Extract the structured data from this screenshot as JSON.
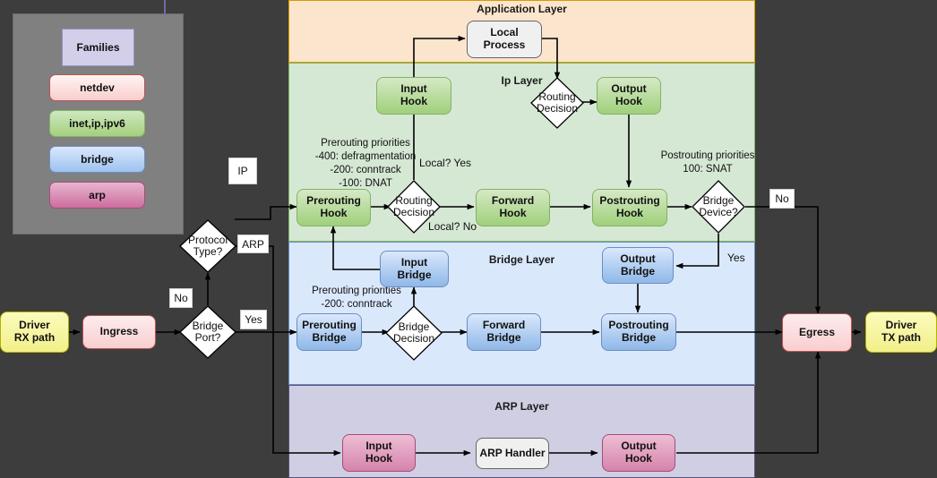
{
  "legend": {
    "title": "Families",
    "items": [
      {
        "label": "netdev",
        "color": "#f8cecc"
      },
      {
        "label": "inet,ip,ipv6",
        "color": "#a4d07f"
      },
      {
        "label": "bridge",
        "color": "#9cc2ef"
      },
      {
        "label": "arp",
        "color": "#cd6d9e"
      }
    ]
  },
  "layers": [
    {
      "key": "application",
      "title": "Application Layer",
      "bg": "#fce5cd",
      "border": "#d79b00"
    },
    {
      "key": "ip",
      "title": "Ip Layer",
      "bg": "#d5e8d4",
      "border": "#82b366"
    },
    {
      "key": "bridge",
      "title": "Bridge Layer",
      "bg": "#dae8fc",
      "border": "#6c8ebf"
    },
    {
      "key": "arp",
      "title": "ARP Layer",
      "bg": "#d0cee2",
      "border": "#56517e"
    }
  ],
  "nodes": {
    "driver_rx": "Driver\nRX path",
    "ingress": "Ingress",
    "egress": "Egress",
    "driver_tx": "Driver\nTX path",
    "local_process": "Local\nProcess",
    "ip_input_hook": "Input\nHook",
    "ip_output_hook": "Output\nHook",
    "ip_prerouting_hook": "Prerouting\nHook",
    "ip_forward_hook": "Forward\nHook",
    "ip_postrouting_hook": "Postrouting\nHook",
    "bridge_input": "Input\nBridge",
    "bridge_output": "Output\nBridge",
    "bridge_prerouting": "Prerouting\nBridge",
    "bridge_forward": "Forward\nBridge",
    "bridge_postrouting": "Postrouting\nBridge",
    "arp_input_hook": "Input\nHook",
    "arp_handler": "ARP Handler",
    "arp_output_hook": "Output\nHook"
  },
  "decisions": {
    "bridge_port": "Bridge\nPort?",
    "protocol_type": "Protocol\nType?",
    "ip_routing": "Routing\nDecision",
    "ip_routing_top": "Routing\nDecision",
    "bridge_device": "Bridge\nDevice?",
    "bridge_decision": "Bridge\nDecision"
  },
  "edge_labels": {
    "bridge_port_no": "No",
    "bridge_port_yes": "Yes",
    "protocol_ip": "IP",
    "protocol_arp": "ARP",
    "bridge_device_no": "No",
    "bridge_device_yes": "Yes",
    "local_yes": "Local? Yes",
    "local_no": "Local? No"
  },
  "notes": {
    "ip_prerouting_priorities": "Prerouting priorities\n-400: defragmentation\n-200: conntrack\n-100: DNAT",
    "ip_postrouting_priorities": "Postrouting priorities\n100: SNAT",
    "bridge_prerouting_priorities": "Prerouting priorities\n-200: conntrack"
  }
}
